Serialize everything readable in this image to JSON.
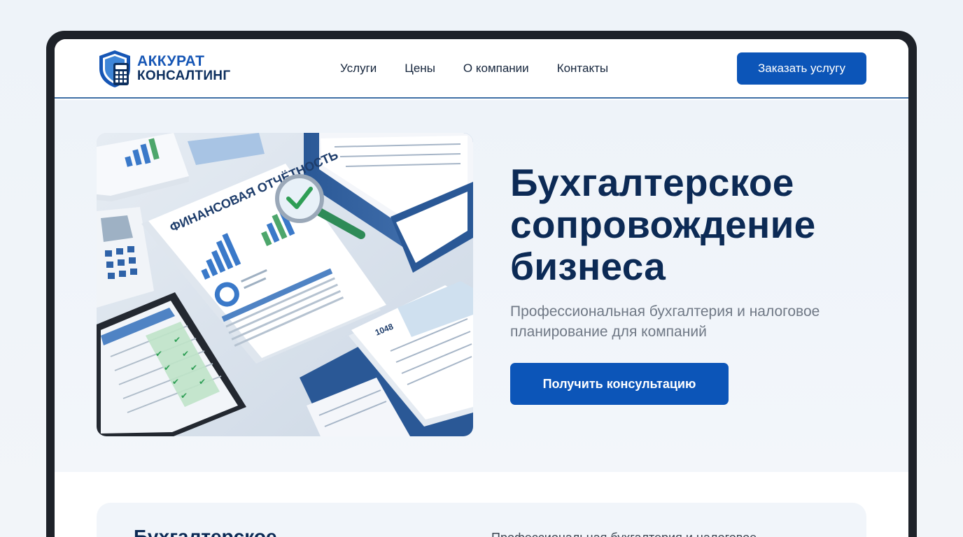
{
  "brand": {
    "line1": "АККУРАТ",
    "line2": "КОНСАЛТИНГ",
    "primary_color": "#1656b5",
    "dark_color": "#0d2f5e"
  },
  "nav": {
    "items": [
      {
        "label": "Услуги"
      },
      {
        "label": "Цены"
      },
      {
        "label": "О компании"
      },
      {
        "label": "Контакты"
      }
    ],
    "order_button": "Заказать услугу"
  },
  "hero": {
    "title": "Бухгалтерское сопровождение бизнеса",
    "subtitle": "Профессиональная бухгалтерия и налоговое планирование для компаний",
    "cta": "Получить консультацию",
    "image": {
      "doc_heading": "ФИНАНСОВАЯ ОТЧЁТНОСТЬ",
      "form_number": "1048"
    }
  },
  "card": {
    "title": "Бухгалтерское",
    "text": "Профессиональная бухгалтерия и налоговое"
  }
}
